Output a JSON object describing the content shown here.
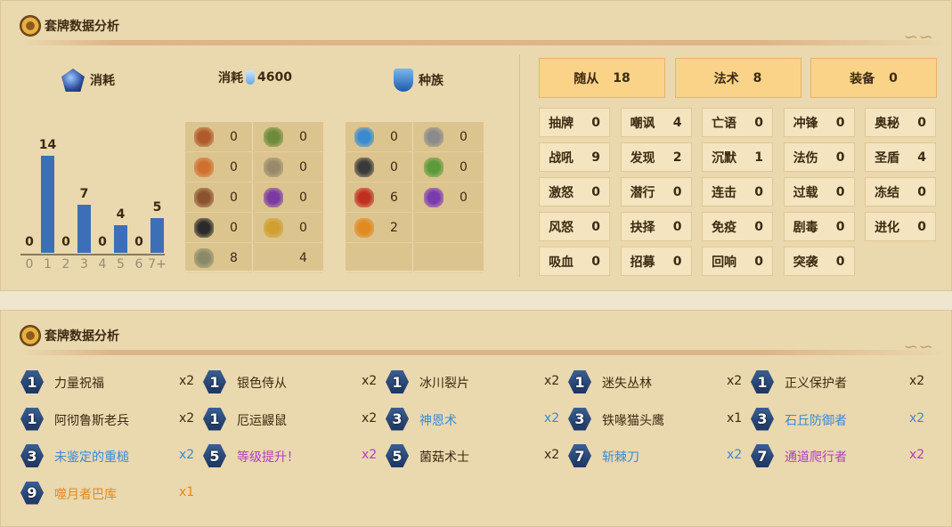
{
  "panel1": {
    "title": "套牌数据分析"
  },
  "panel2": {
    "title": "套牌数据分析"
  },
  "mana": {
    "label": "消耗",
    "chart_data": {
      "type": "bar",
      "categories": [
        "0",
        "1",
        "2",
        "3",
        "4",
        "5",
        "6",
        "7+"
      ],
      "values": [
        0,
        14,
        0,
        7,
        0,
        4,
        0,
        5
      ],
      "ylim": [
        0,
        14
      ]
    }
  },
  "dust": {
    "label": "消耗",
    "value": "4600"
  },
  "race": {
    "label": "种族"
  },
  "type_icons": [
    {
      "icon": "spider-icon",
      "color": "#b05a2a",
      "value": "0"
    },
    {
      "icon": "leaf-icon",
      "color": "#6e8a3a",
      "value": "0"
    },
    {
      "icon": "pyramid-icon",
      "color": "#d07030",
      "value": "0"
    },
    {
      "icon": "shield-crest-icon",
      "color": "#9a8a6a",
      "value": "0"
    },
    {
      "icon": "hat-icon",
      "color": "#8a5230",
      "value": "0"
    },
    {
      "icon": "purple-ring-icon",
      "color": "#7a3aa0",
      "value": "0"
    },
    {
      "icon": "music-note-icon",
      "color": "#2a2a2a",
      "value": "0"
    },
    {
      "icon": "gold-chain-icon",
      "color": "#d0a030",
      "value": "0"
    },
    {
      "icon": "claw-icon",
      "color": "#8a8a6a",
      "value": "8"
    },
    {
      "icon": "blank",
      "color": "",
      "value": "4"
    }
  ],
  "race_icons": [
    {
      "icon": "elemental-icon",
      "color": "#3a8ad0",
      "value": "0"
    },
    {
      "icon": "mech-gear-icon",
      "color": "#8a8a8a",
      "value": "0"
    },
    {
      "icon": "pirate-skull-icon",
      "color": "#3a3a3a",
      "value": "0"
    },
    {
      "icon": "dragon-icon",
      "color": "#5a9a3a",
      "value": "0"
    },
    {
      "icon": "beast-paw-icon",
      "color": "#c03020",
      "value": "6"
    },
    {
      "icon": "demon-icon",
      "color": "#7a3ab0",
      "value": "0"
    },
    {
      "icon": "totem-icon",
      "color": "#e08a20",
      "value": "2"
    }
  ],
  "types": [
    {
      "label": "随从",
      "value": "18"
    },
    {
      "label": "法术",
      "value": "8"
    },
    {
      "label": "装备",
      "value": "0"
    }
  ],
  "keywords": [
    {
      "label": "抽牌",
      "value": "0"
    },
    {
      "label": "嘲讽",
      "value": "4"
    },
    {
      "label": "亡语",
      "value": "0"
    },
    {
      "label": "冲锋",
      "value": "0"
    },
    {
      "label": "奥秘",
      "value": "0"
    },
    {
      "label": "战吼",
      "value": "9"
    },
    {
      "label": "发现",
      "value": "2"
    },
    {
      "label": "沉默",
      "value": "1"
    },
    {
      "label": "法伤",
      "value": "0"
    },
    {
      "label": "圣盾",
      "value": "4"
    },
    {
      "label": "激怒",
      "value": "0"
    },
    {
      "label": "潜行",
      "value": "0"
    },
    {
      "label": "连击",
      "value": "0"
    },
    {
      "label": "过载",
      "value": "0"
    },
    {
      "label": "冻结",
      "value": "0"
    },
    {
      "label": "风怒",
      "value": "0"
    },
    {
      "label": "抉择",
      "value": "0"
    },
    {
      "label": "免疫",
      "value": "0"
    },
    {
      "label": "剧毒",
      "value": "0"
    },
    {
      "label": "进化",
      "value": "0"
    },
    {
      "label": "吸血",
      "value": "0"
    },
    {
      "label": "招募",
      "value": "0"
    },
    {
      "label": "回响",
      "value": "0"
    },
    {
      "label": "突袭",
      "value": "0"
    }
  ],
  "cards": [
    {
      "cost": "1",
      "name": "力量祝福",
      "count": "x2",
      "color": "#3d2a12"
    },
    {
      "cost": "1",
      "name": "银色侍从",
      "count": "x2",
      "color": "#3d2a12"
    },
    {
      "cost": "1",
      "name": "冰川裂片",
      "count": "x2",
      "color": "#3d2a12"
    },
    {
      "cost": "1",
      "name": "迷失丛林",
      "count": "x2",
      "color": "#3d2a12"
    },
    {
      "cost": "1",
      "name": "正义保护者",
      "count": "x2",
      "color": "#3d2a12"
    },
    {
      "cost": "1",
      "name": "阿彻鲁斯老兵",
      "count": "x2",
      "color": "#3d2a12"
    },
    {
      "cost": "1",
      "name": "厄运鼹鼠",
      "count": "x2",
      "color": "#3d2a12"
    },
    {
      "cost": "3",
      "name": "神恩术",
      "count": "x2",
      "color": "#3a8ad8"
    },
    {
      "cost": "3",
      "name": "铁喙猫头鹰",
      "count": "x1",
      "color": "#3d2a12"
    },
    {
      "cost": "3",
      "name": "石丘防御者",
      "count": "x2",
      "color": "#3a8ad8"
    },
    {
      "cost": "3",
      "name": "未鉴定的重槌",
      "count": "x2",
      "color": "#3a8ad8"
    },
    {
      "cost": "5",
      "name": "等级提升！",
      "count": "x2",
      "color": "#b040c0"
    },
    {
      "cost": "5",
      "name": "菌菇术士",
      "count": "x2",
      "color": "#3d2a12"
    },
    {
      "cost": "7",
      "name": "斩棘刀",
      "count": "x2",
      "color": "#3a8ad8"
    },
    {
      "cost": "7",
      "name": "通道爬行者",
      "count": "x2",
      "color": "#b040c0"
    },
    {
      "cost": "9",
      "name": "噬月者巴库",
      "count": "x1",
      "color": "#e08a20"
    }
  ]
}
